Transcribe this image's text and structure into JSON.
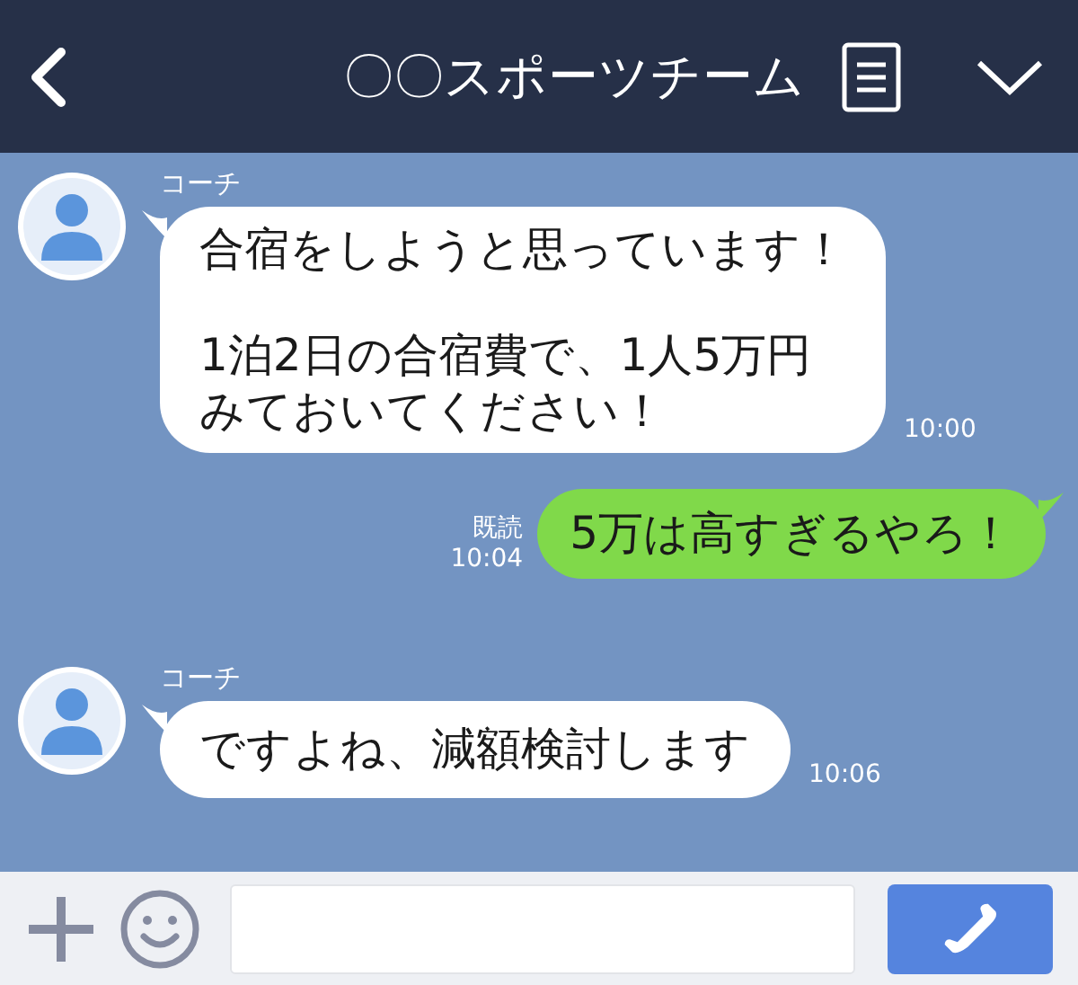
{
  "header": {
    "title": "〇〇スポーツチーム"
  },
  "messages": [
    {
      "kind": "incoming",
      "sender": "コーチ",
      "paragraphs": [
        "合宿をしようと思っています！",
        "1泊2日の合宿費で、1人5万円みておいてください！"
      ],
      "time": "10:00"
    },
    {
      "kind": "outgoing",
      "read": "既読",
      "text": "5万は高すぎるやろ！",
      "time": "10:04"
    },
    {
      "kind": "incoming",
      "sender": "コーチ",
      "text": "ですよね、減額検討します",
      "time": "10:06"
    }
  ]
}
